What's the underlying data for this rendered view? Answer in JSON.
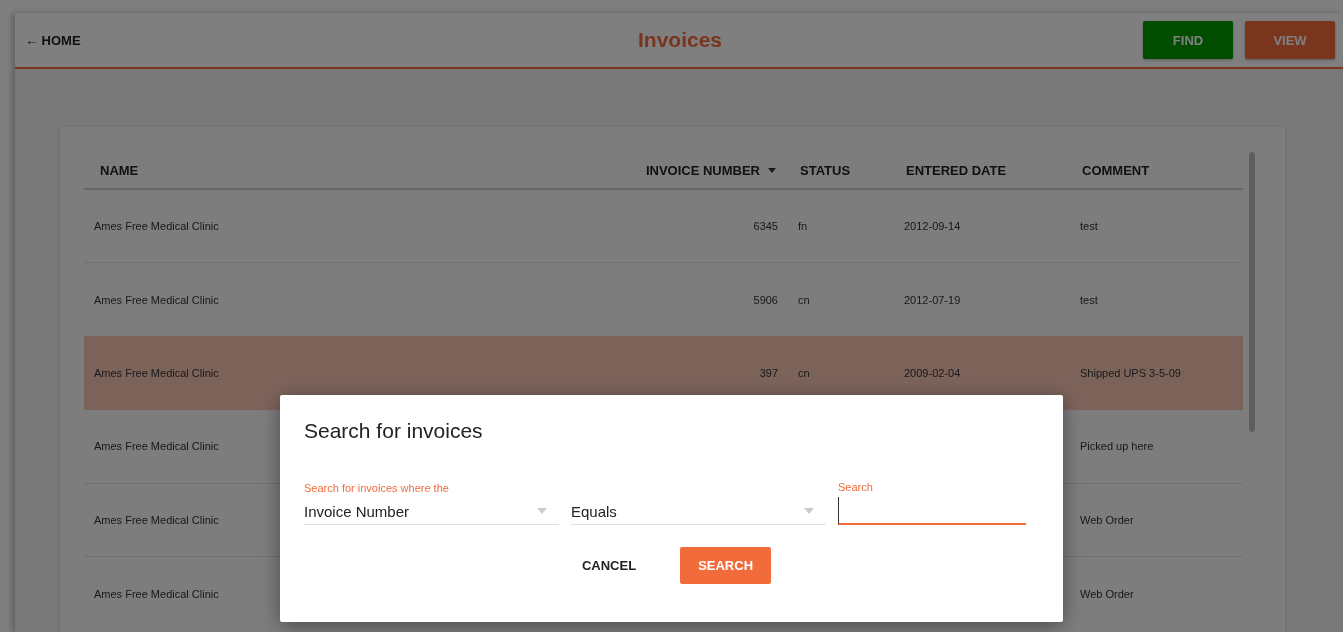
{
  "header": {
    "back_link": "← HOME",
    "title": "Invoices",
    "buttons": [
      {
        "label": "FIND",
        "kind": "find"
      },
      {
        "label": "VIEW",
        "kind": "view"
      }
    ]
  },
  "table": {
    "columns": [
      {
        "label": "NAME",
        "sorted": false
      },
      {
        "label": "INVOICE NUMBER",
        "sorted": true
      },
      {
        "label": "STATUS",
        "sorted": false
      },
      {
        "label": "ENTERED DATE",
        "sorted": false
      },
      {
        "label": "COMMENT",
        "sorted": false
      }
    ],
    "rows": [
      {
        "selected": false,
        "cells": [
          "Ames Free Medical Clinic",
          "6345",
          "fn",
          "2012-09-14",
          "test"
        ]
      },
      {
        "selected": false,
        "cells": [
          "Ames Free Medical Clinic",
          "5906",
          "cn",
          "2012-07-19",
          "test"
        ]
      },
      {
        "selected": true,
        "cells": [
          "Ames Free Medical Clinic",
          "397",
          "cn",
          "2009-02-04",
          "Shipped UPS 3-5-09"
        ]
      },
      {
        "selected": false,
        "cells": [
          "Ames Free Medical Clinic",
          null,
          null,
          null,
          "Picked up here"
        ]
      },
      {
        "selected": false,
        "cells": [
          "Ames Free Medical Clinic",
          null,
          null,
          null,
          "Web Order"
        ]
      },
      {
        "selected": false,
        "cells": [
          "Ames Free Medical Clinic",
          null,
          null,
          null,
          "Web Order"
        ]
      }
    ]
  },
  "dialog": {
    "title": "Search for invoices",
    "fields": [
      {
        "kind": "select",
        "label": "Search for invoices where the",
        "value": "Invoice Number",
        "focused": false
      },
      {
        "kind": "select",
        "value": "Equals",
        "focused": false
      },
      {
        "kind": "text",
        "label": "Search",
        "focused": true
      }
    ],
    "buttons": [
      {
        "label": "CANCEL",
        "kind": "flat"
      },
      {
        "label": "SEARCH",
        "kind": "raised"
      }
    ]
  }
}
